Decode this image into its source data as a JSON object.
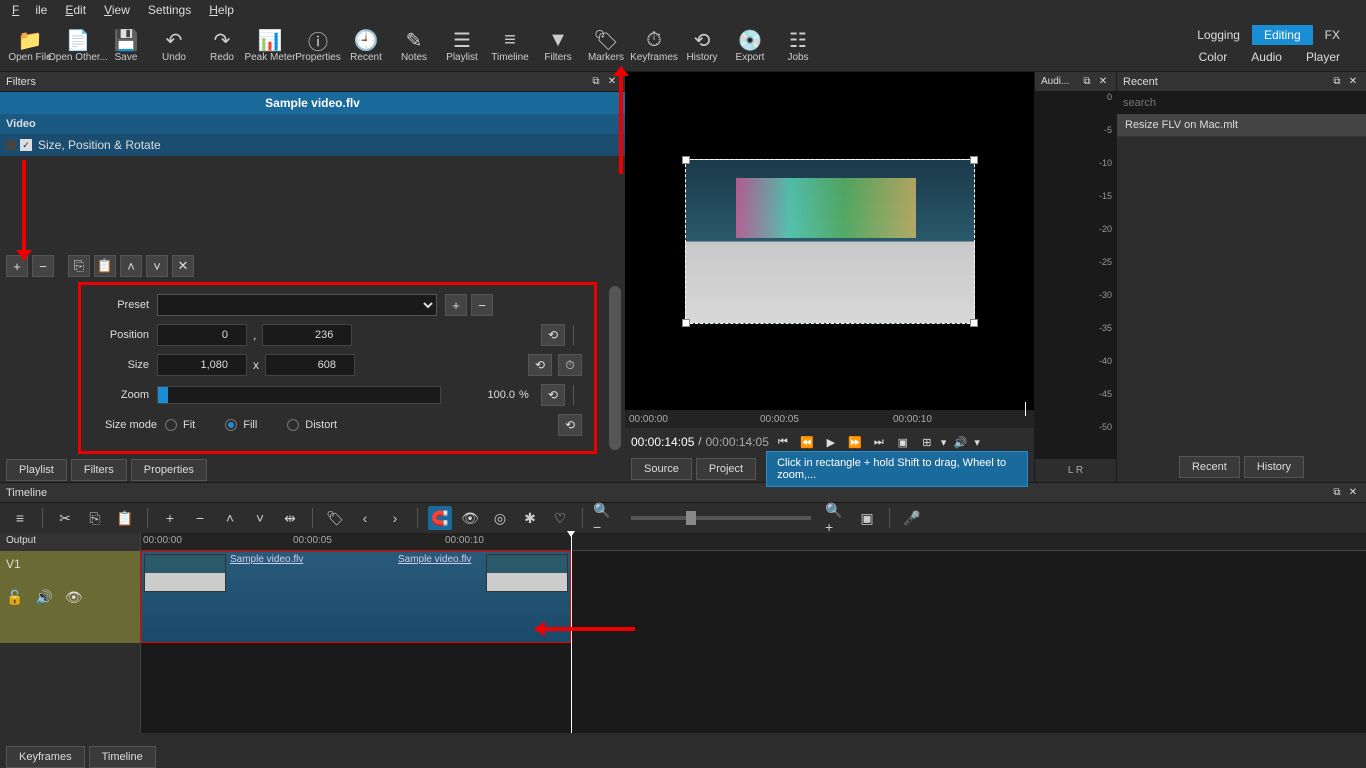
{
  "menu": {
    "file": "File",
    "edit": "Edit",
    "view": "View",
    "settings": "Settings",
    "help": "Help"
  },
  "toolbar": [
    {
      "icon": "📁",
      "label": "Open File"
    },
    {
      "icon": "📄",
      "label": "Open Other..."
    },
    {
      "icon": "💾",
      "label": "Save"
    },
    {
      "icon": "↶",
      "label": "Undo"
    },
    {
      "icon": "↷",
      "label": "Redo"
    },
    {
      "icon": "📊",
      "label": "Peak Meter"
    },
    {
      "icon": "ⓘ",
      "label": "Properties"
    },
    {
      "icon": "🕘",
      "label": "Recent"
    },
    {
      "icon": "✎",
      "label": "Notes"
    },
    {
      "icon": "☰",
      "label": "Playlist"
    },
    {
      "icon": "≡",
      "label": "Timeline"
    },
    {
      "icon": "▼",
      "label": "Filters"
    },
    {
      "icon": "🏷",
      "label": "Markers"
    },
    {
      "icon": "⏱",
      "label": "Keyframes"
    },
    {
      "icon": "⟲",
      "label": "History"
    },
    {
      "icon": "💿",
      "label": "Export"
    },
    {
      "icon": "☷",
      "label": "Jobs"
    }
  ],
  "modes": {
    "row1": [
      "Logging",
      "Editing",
      "FX"
    ],
    "row2": [
      "Color",
      "Audio",
      "Player"
    ],
    "active": "Editing"
  },
  "filters_panel": {
    "title": "Filters",
    "clip": "Sample video.flv",
    "category": "Video",
    "items": [
      "Size, Position & Rotate"
    ]
  },
  "params": {
    "preset_label": "Preset",
    "position_label": "Position",
    "pos_x": "0",
    "pos_y": "236",
    "size_label": "Size",
    "size_w": "1,080",
    "size_h": "608",
    "zoom_label": "Zoom",
    "zoom_val": "100.0",
    "zoom_unit": "%",
    "mode_label": "Size mode",
    "mode_fit": "Fit",
    "mode_fill": "Fill",
    "mode_distort": "Distort"
  },
  "preview": {
    "ruler": [
      "00:00:00",
      "00:00:05",
      "00:00:10"
    ],
    "tc_current": "00:00:14:05",
    "tc_total": "00:00:14:05",
    "source": "Source",
    "project": "Project",
    "hint": "Click in rectangle + hold Shift to drag, Wheel to zoom,..."
  },
  "audio": {
    "title": "Audi...",
    "levels": [
      "0",
      "-5",
      "-10",
      "-15",
      "-20",
      "-25",
      "-30",
      "-35",
      "-40",
      "-45",
      "-50"
    ],
    "lr": "L   R"
  },
  "recent": {
    "title": "Recent",
    "placeholder": "search",
    "items": [
      "Resize FLV on Mac.mlt"
    ],
    "btn_recent": "Recent",
    "btn_history": "History"
  },
  "tabs": {
    "playlist": "Playlist",
    "filters": "Filters",
    "properties": "Properties"
  },
  "timeline": {
    "title": "Timeline",
    "ruler": [
      "00:00:00",
      "00:00:05",
      "00:00:10"
    ],
    "output": "Output",
    "track": "V1",
    "clip1": "Sample video.flv",
    "clip2": "Sample video.flv"
  },
  "bottom": {
    "keyframes": "Keyframes",
    "timeline": "Timeline"
  }
}
